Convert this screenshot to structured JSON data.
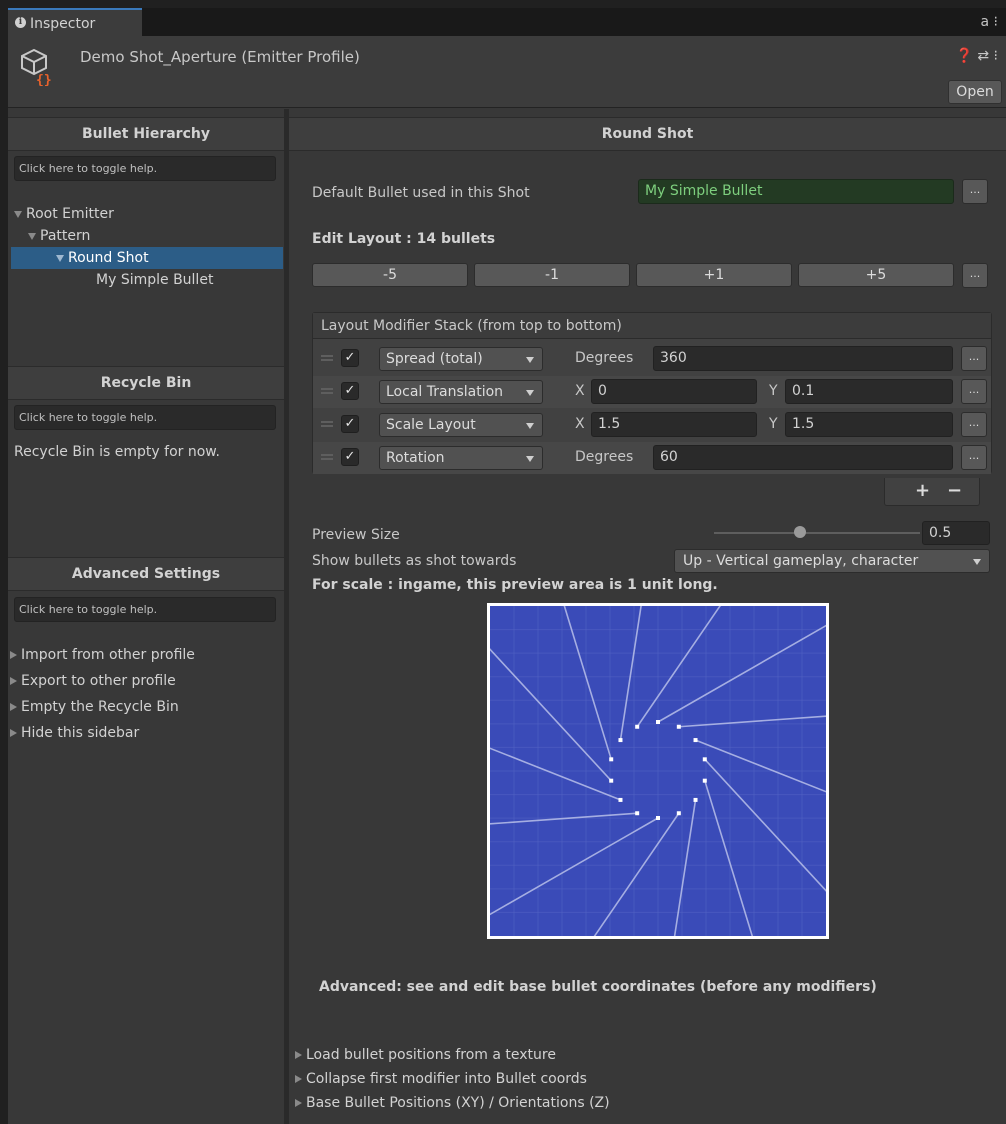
{
  "tab": {
    "title": "Inspector",
    "icons": "a ⁝"
  },
  "header": {
    "title": "Demo Shot_Aperture (Emitter Profile)",
    "icons": "❓ ⇄ ⁝",
    "open_label": "Open"
  },
  "sidebar": {
    "hierarchy_title": "Bullet Hierarchy",
    "help_text": "Click here to toggle help.",
    "tree": [
      {
        "label": "Root Emitter"
      },
      {
        "label": "Pattern"
      },
      {
        "label": "Round Shot"
      },
      {
        "label": "My Simple Bullet"
      }
    ],
    "recycle_title": "Recycle Bin",
    "recycle_help": "Click here to toggle help.",
    "recycle_empty": "Recycle Bin is empty for now.",
    "advanced_title": "Advanced Settings",
    "advanced_help": "Click here to toggle help.",
    "advanced_items": [
      "Import from other profile",
      "Export to other profile",
      "Empty the Recycle Bin",
      "Hide this sidebar"
    ]
  },
  "main": {
    "title": "Round Shot",
    "default_bullet_label": "Default Bullet used in this Shot",
    "default_bullet_value": "My Simple Bullet",
    "dots": "...",
    "edit_layout": "Edit Layout : 14 bullets",
    "layout_buttons": [
      "-5",
      "-1",
      "+1",
      "+5"
    ],
    "stack_title": "Layout Modifier Stack (from top to bottom)",
    "check": "✓",
    "modifiers": [
      {
        "type": "Spread (total)",
        "label1": "Degrees",
        "value1": "360"
      },
      {
        "type": "Local Translation",
        "label1": "X",
        "value1": "0",
        "label2": "Y",
        "value2": "0.1"
      },
      {
        "type": "Scale Layout",
        "label1": "X",
        "value1": "1.5",
        "label2": "Y",
        "value2": "1.5"
      },
      {
        "type": "Rotation",
        "label1": "Degrees",
        "value1": "60"
      }
    ],
    "plus": "+",
    "minus": "−",
    "preview_size_label": "Preview Size",
    "preview_size_value": "0.5",
    "preview_size_level": 0.5,
    "show_towards_label": "Show bullets as shot towards",
    "show_towards_value": "Up - Vertical gameplay, character",
    "scale_note": "For scale : ingame, this preview area is 1 unit long.",
    "advanced_note": "Advanced: see and edit base bullet coordinates (before any modifiers)",
    "folds": [
      "Load bullet positions from a texture",
      "Collapse first modifier into Bullet coords",
      "Base Bullet Positions (XY) / Orientations (Z)"
    ]
  },
  "colors": {
    "selection": "#2c5d87",
    "preview_bg": "#3a4bb8",
    "accent_tab": "#3a79bb",
    "green_text": "#7ecf7e"
  }
}
